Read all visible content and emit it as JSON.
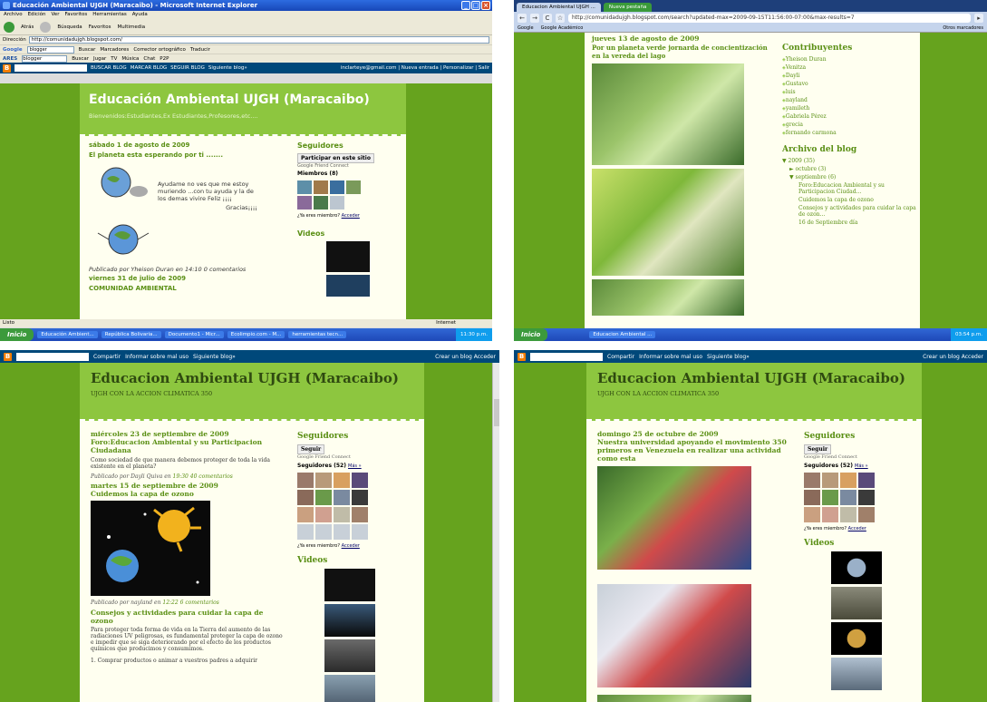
{
  "q1": {
    "window_title": "Educación Ambiental UJGH (Maracaibo) - Microsoft Internet Explorer",
    "menu": [
      "Archivo",
      "Edición",
      "Ver",
      "Favoritos",
      "Herramientas",
      "Ayuda"
    ],
    "toolbar": [
      "Atrás",
      "Búsqueda",
      "Favoritos",
      "Multimedia"
    ],
    "address_label": "Dirección",
    "address": "http://comunidadujgh.blogspot.com/",
    "google_query": "blogger",
    "google_items": [
      "Buscar",
      "Marcadores",
      "Corrector ortográfico",
      "Traducir"
    ],
    "ares_items": [
      "ARES",
      "blogger",
      "Buscar",
      "Jugar",
      "TV",
      "Música",
      "Chat",
      "P2P"
    ],
    "blogger_bar": [
      "BUSCAR BLOG",
      "MARCAR BLOG",
      "SEGUIR BLOG",
      "Siguiente blog»"
    ],
    "blogger_user": "inclarteye@gmail.com | Nueva entrada | Personalizar | Salir",
    "blog_title": "Educación Ambiental UJGH (Maracaibo)",
    "blog_subtitle": "Bienvenidos:Estudiantes,Ex Estudiantes,Profesores,etc....",
    "post_date": "sábado 1 de agosto de 2009",
    "post_title": "El planeta esta esperando por ti .......",
    "post_text": "Ayudame no ves que me estoy muriendo ...con tu ayuda y la de los demas vivire Feliz ¡¡¡¡",
    "post_text2": "Gracias¡¡¡¡",
    "post_meta": "Publicado por Yheison Duran en 14:10 0 comentarios",
    "post2_date": "viernes 31 de julio de 2009",
    "post2_title": "COMUNIDAD AMBIENTAL",
    "side_followers": "Seguidores",
    "join_btn": "Participar en este sitio",
    "gfc": "Google Friend Connect",
    "members": "Miembros (8)",
    "already": "¿Ya eres miembro?",
    "login": "Acceder",
    "videos": "Videos",
    "status": "Listo",
    "status_zone": "Internet",
    "start": "Inicio",
    "tasks": [
      "Educación Ambient...",
      "República Bolivaria...",
      "Documento1 - Micr...",
      "Ecolimpio.com - M...",
      "herramientas tecn..."
    ],
    "clock": "11:30 p.m."
  },
  "q2": {
    "tabs": [
      "Educacion Ambiental UJGH ...",
      "Nueva pestaña"
    ],
    "url": "http://comunidadujgh.blogspot.com/search?updated-max=2009-09-15T11:56:00-07:00&max-results=7",
    "bookmarks": [
      "Google",
      "Google Académico"
    ],
    "other_bm": "Otros marcadores",
    "post_date": "jueves 13 de agosto de 2009",
    "post_title": "Por un planeta verde jornarda de concientización en la vereda del lago",
    "contrib_h": "Contribuyentes",
    "contributors": [
      "Yheison Duran",
      "Venitza",
      "Dayli",
      "Gustavo",
      "luis",
      "nayland",
      "yamileth",
      "Gabriela Pérez",
      "grecia",
      "fernando carmona"
    ],
    "archive_h": "Archivo del blog",
    "archive": [
      "▼ 2009 (35)",
      "► octubre (3)",
      "▼ septiembre (6)",
      "Foro:Educacion Ambiental y su Participacion Ciudad...",
      "Cuidemos la capa de ozono",
      "Consejos y actividades para cuidar la capa de ozon...",
      "16 de Septiembre día"
    ],
    "start": "Inicio",
    "task": "Educacion Ambiental ...",
    "clock": "03:54 p.m."
  },
  "q3": {
    "nav": [
      "Compartir",
      "Informar sobre mal uso",
      "Siguiente blog»"
    ],
    "nav_right": "Crear un blog   Acceder",
    "title": "Educacion Ambiental UJGH (Maracaibo)",
    "subtitle": "UJGH CON LA ACCION CLIMATICA 350",
    "date1": "miércoles 23 de septiembre de 2009",
    "title1": "Foro:Educacion Ambiental y su Participacion Ciudadana",
    "text1": "Como sociedad de que manera debemos proteger de toda la vida existente en el planeta?",
    "meta1_by": "Publicado por Dayli Quiva en",
    "meta1_link": "19:30 40 comentarios",
    "date2": "martes 15 de septiembre de 2009",
    "title2": "Cuidemos la capa de ozono",
    "meta2_by": "Publicado por nayland en",
    "meta2_link": "12:22 6 comentarios",
    "title3": "Consejos y actividades para cuidar la capa de ozono",
    "text3": "Para proteger toda forma de vida en la Tierra del aumento de las radiaciones UV peligrosas, es fundamental proteger la capa de ozono e impedir que se siga deteriorando por el efecto de los productos químicos que producimos y consumimos.",
    "text4": "1. Comprar productos o animar a vuestros padres a adquirir",
    "followers_h": "Seguidores",
    "follow_btn": "Seguir",
    "gfc": "Google Friend Connect",
    "followers": "Seguidores (52)",
    "more": "Más »",
    "already": "¿Ya eres miembro?",
    "login": "Acceder",
    "videos": "Videos"
  },
  "q4": {
    "nav": [
      "Compartir",
      "Informar sobre mal uso",
      "Siguiente blog»"
    ],
    "nav_right": "Crear un blog   Acceder",
    "title": "Educacion Ambiental UJGH (Maracaibo)",
    "subtitle": "UJGH CON LA ACCION CLIMATICA 350",
    "date1": "domingo 25 de octubre de 2009",
    "title1": "Nuestra universidad apoyando el movimiento 350 primeros en Venezuela en realizar una actividad como esta",
    "followers_h": "Seguidores",
    "follow_btn": "Seguir",
    "gfc": "Google Friend Connect",
    "followers": "Seguidores (52)",
    "more": "Más »",
    "already": "¿Ya eres miembro?",
    "login": "Acceder",
    "videos": "Videos"
  }
}
